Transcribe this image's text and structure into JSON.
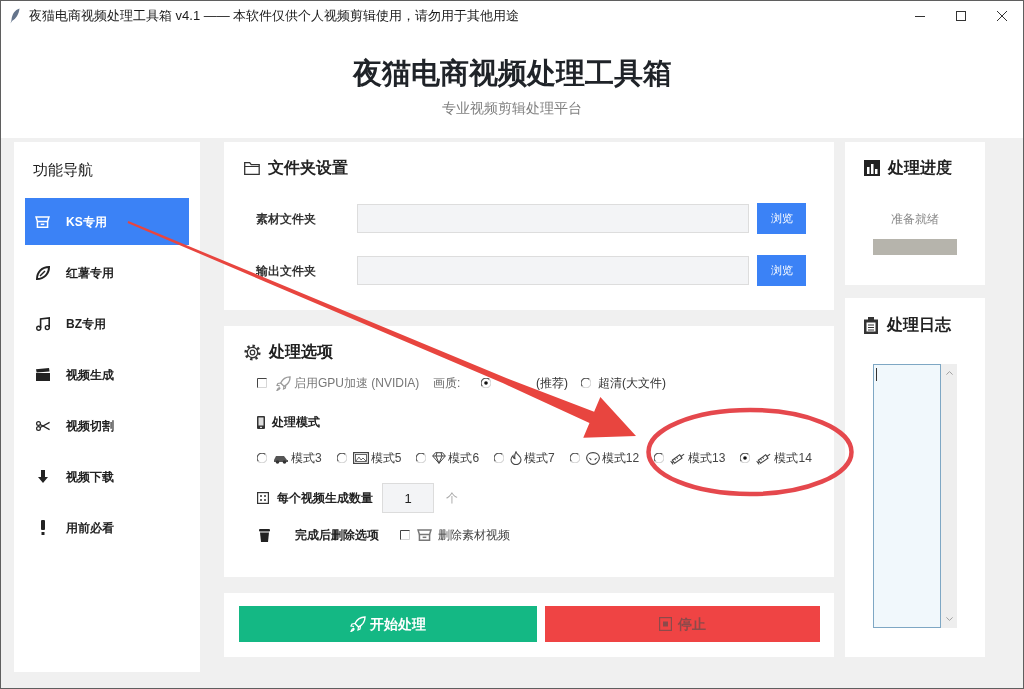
{
  "window": {
    "title": "夜猫电商视频处理工具箱 v4.1 —— 本软件仅供个人视频剪辑使用，请勿用于其他用途"
  },
  "header": {
    "title": "夜猫电商视频处理工具箱",
    "subtitle": "专业视频剪辑处理平台"
  },
  "sidebar": {
    "title": "功能导航",
    "items": [
      {
        "label": "KS专用",
        "selected": true
      },
      {
        "label": "红薯专用",
        "selected": false
      },
      {
        "label": "BZ专用",
        "selected": false
      },
      {
        "label": "视频生成",
        "selected": false
      },
      {
        "label": "视频切割",
        "selected": false
      },
      {
        "label": "视频下载",
        "selected": false
      },
      {
        "label": "用前必看",
        "selected": false
      }
    ]
  },
  "folders": {
    "title": "文件夹设置",
    "rows": [
      {
        "label": "素材文件夹",
        "button": "浏览"
      },
      {
        "label": "输出文件夹",
        "button": "浏览"
      }
    ]
  },
  "options": {
    "title": "处理选项",
    "gpu": {
      "label": "启用GPU加速 (NVIDIA)",
      "checked": false
    },
    "quality": {
      "label": "画质:",
      "choices": [
        {
          "label": "(推荐)",
          "selected": true
        },
        {
          "label": "超清(大文件)",
          "selected": false
        }
      ]
    },
    "mode": {
      "title": "处理模式",
      "choices": [
        {
          "label": "模式3",
          "selected": false
        },
        {
          "label": "模式5",
          "selected": false
        },
        {
          "label": "模式6",
          "selected": false
        },
        {
          "label": "模式7",
          "selected": false
        },
        {
          "label": "模式12",
          "selected": false
        },
        {
          "label": "模式13",
          "selected": false
        },
        {
          "label": "模式14",
          "selected": true
        }
      ]
    },
    "count": {
      "label": "每个视频生成数量",
      "value": "1",
      "unit": "个"
    },
    "cleanup": {
      "label": "完成后删除选项",
      "option": {
        "label": "删除素材视频",
        "checked": false
      }
    }
  },
  "actions": [
    {
      "kind": "start",
      "label": "开始处理",
      "disabled": false
    },
    {
      "kind": "stop",
      "label": "停止",
      "disabled": true
    }
  ],
  "progress": {
    "title": "处理进度",
    "status": "准备就绪",
    "level": 0
  },
  "log": {
    "title": "处理日志"
  }
}
